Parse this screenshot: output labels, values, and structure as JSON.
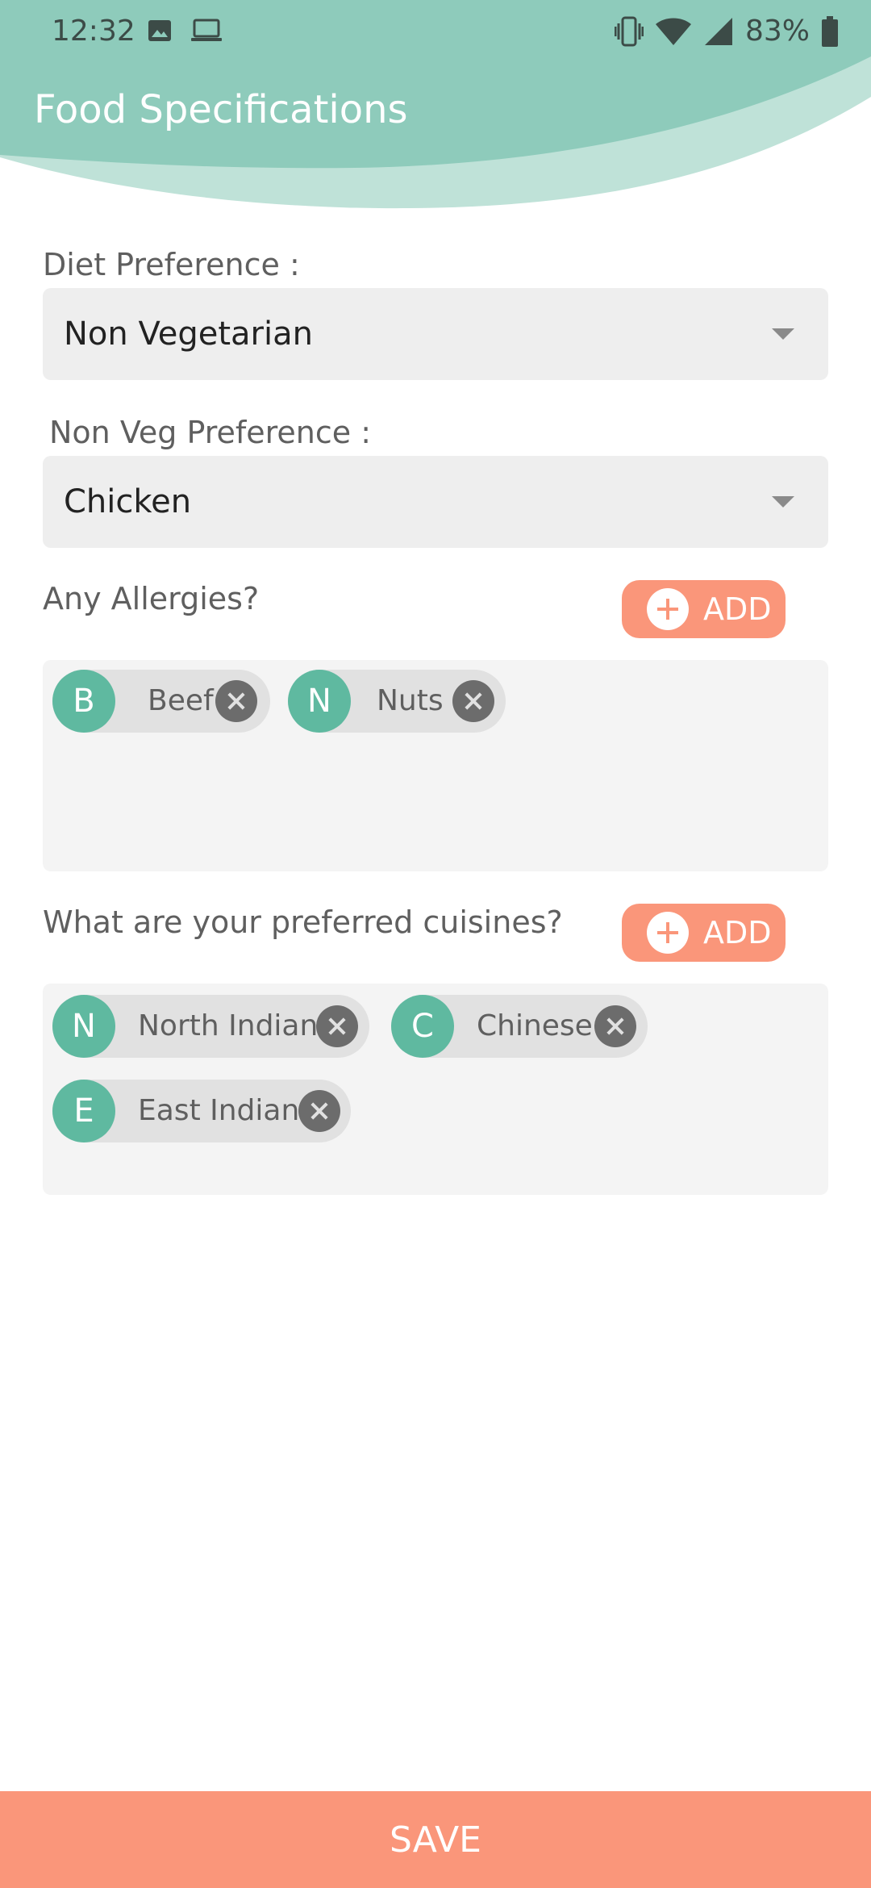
{
  "status_bar": {
    "time": "12:32",
    "battery": "83%"
  },
  "header": {
    "title": "Food Specifications"
  },
  "diet": {
    "label": "Diet Preference :",
    "value": "Non Vegetarian"
  },
  "nonveg": {
    "label": "Non Veg Preference :",
    "value": "Chicken"
  },
  "allergies": {
    "label": "Any Allergies?",
    "add_label": "ADD",
    "chips": [
      {
        "initial": "B",
        "name": "Beef"
      },
      {
        "initial": "N",
        "name": "Nuts"
      }
    ]
  },
  "cuisines": {
    "label": "What are your preferred cuisines?",
    "add_label": "ADD",
    "chips": [
      {
        "initial": "N",
        "name": "North Indian"
      },
      {
        "initial": "C",
        "name": "Chinese"
      },
      {
        "initial": "E",
        "name": "East Indian"
      }
    ]
  },
  "save_label": "SAVE",
  "colors": {
    "header": "#8ecbbb",
    "header_light": "#bfe2d8",
    "accent": "#fa967a",
    "avatar": "#5fb9a0"
  }
}
